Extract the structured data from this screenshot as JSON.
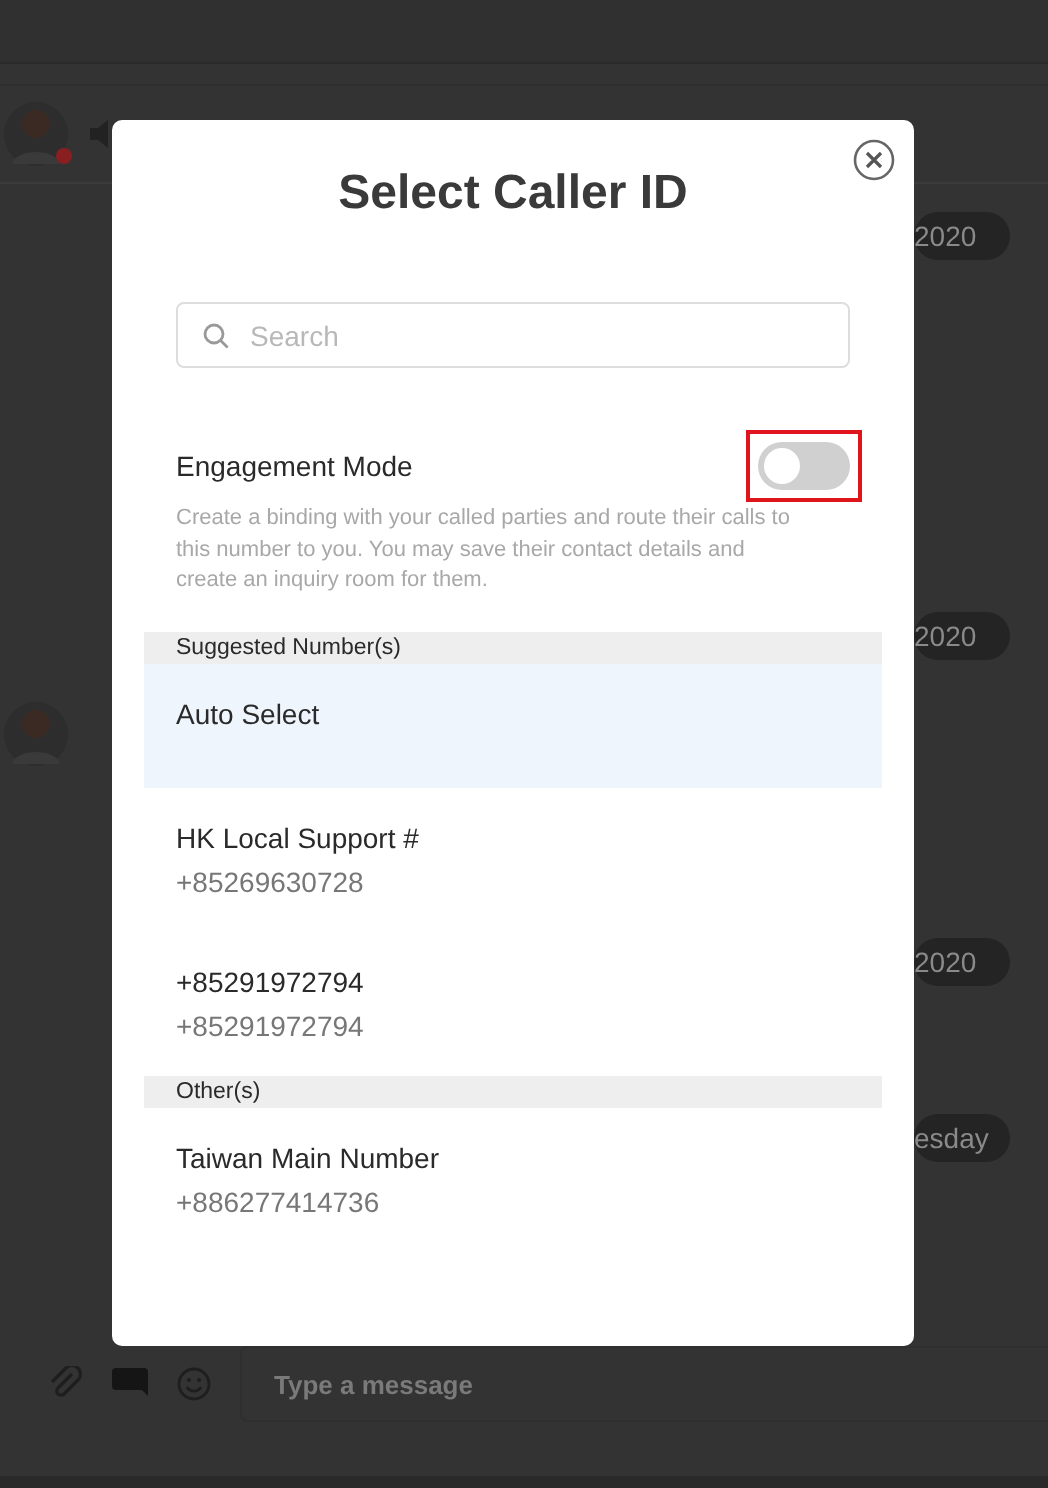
{
  "background": {
    "date_pills": [
      "2020",
      "2020",
      "2020",
      "esday"
    ],
    "composer": {
      "placeholder": "Type a message"
    }
  },
  "dialog": {
    "title": "Select Caller ID",
    "search": {
      "placeholder": "Search"
    },
    "engagement": {
      "label": "Engagement Mode",
      "on": false,
      "highlighted": true,
      "description": "Create a binding with your called parties and route their calls to this number to you. You may save their contact details and create an inquiry room for them."
    },
    "sections": [
      {
        "title": "Suggested Number(s)",
        "items": [
          {
            "name": "Auto Select",
            "selected": true
          },
          {
            "name": "HK Local Support #",
            "number": "+85269630728",
            "selected": false
          },
          {
            "name": "+85291972794",
            "number": "+85291972794",
            "selected": false
          }
        ]
      },
      {
        "title": "Other(s)",
        "items": [
          {
            "name": "Taiwan Main Number",
            "number": "+886277414736",
            "selected": false
          }
        ]
      }
    ]
  }
}
